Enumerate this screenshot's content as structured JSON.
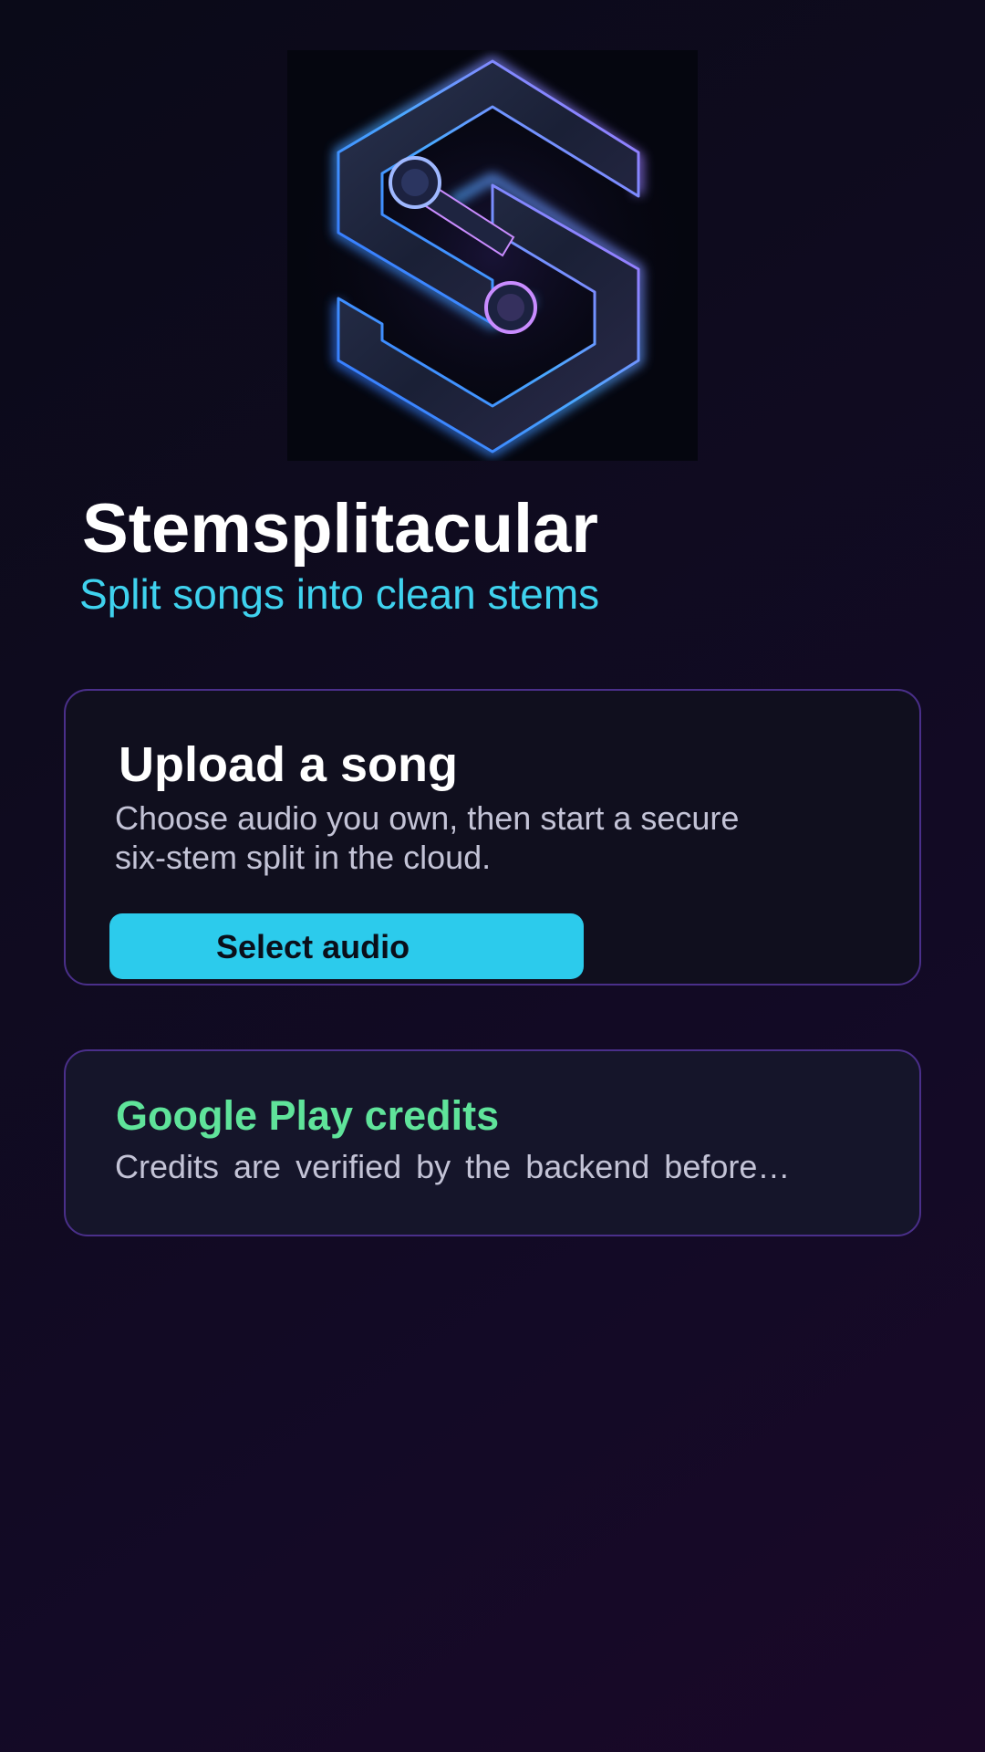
{
  "app": {
    "title": "Stemsplitacular",
    "subtitle": "Split songs into clean stems",
    "logo_icon": "stem-split-s-logo-icon"
  },
  "upload_card": {
    "title": "Upload a song",
    "description": "Choose audio you own, then start a secure six-stem split in the cloud.",
    "button_label": "Select audio"
  },
  "credits_card": {
    "title": "Google Play credits",
    "description": "Credits are verified by the backend before…"
  },
  "colors": {
    "background": "#0f0b1f",
    "accent_cyan": "#2ccbec",
    "subtitle_cyan": "#3fd2ee",
    "credits_green": "#5fe39a",
    "card_border": "#4a2f8a",
    "logo_glow_blue": "#3a7bff",
    "logo_glow_purple": "#b56cff"
  }
}
